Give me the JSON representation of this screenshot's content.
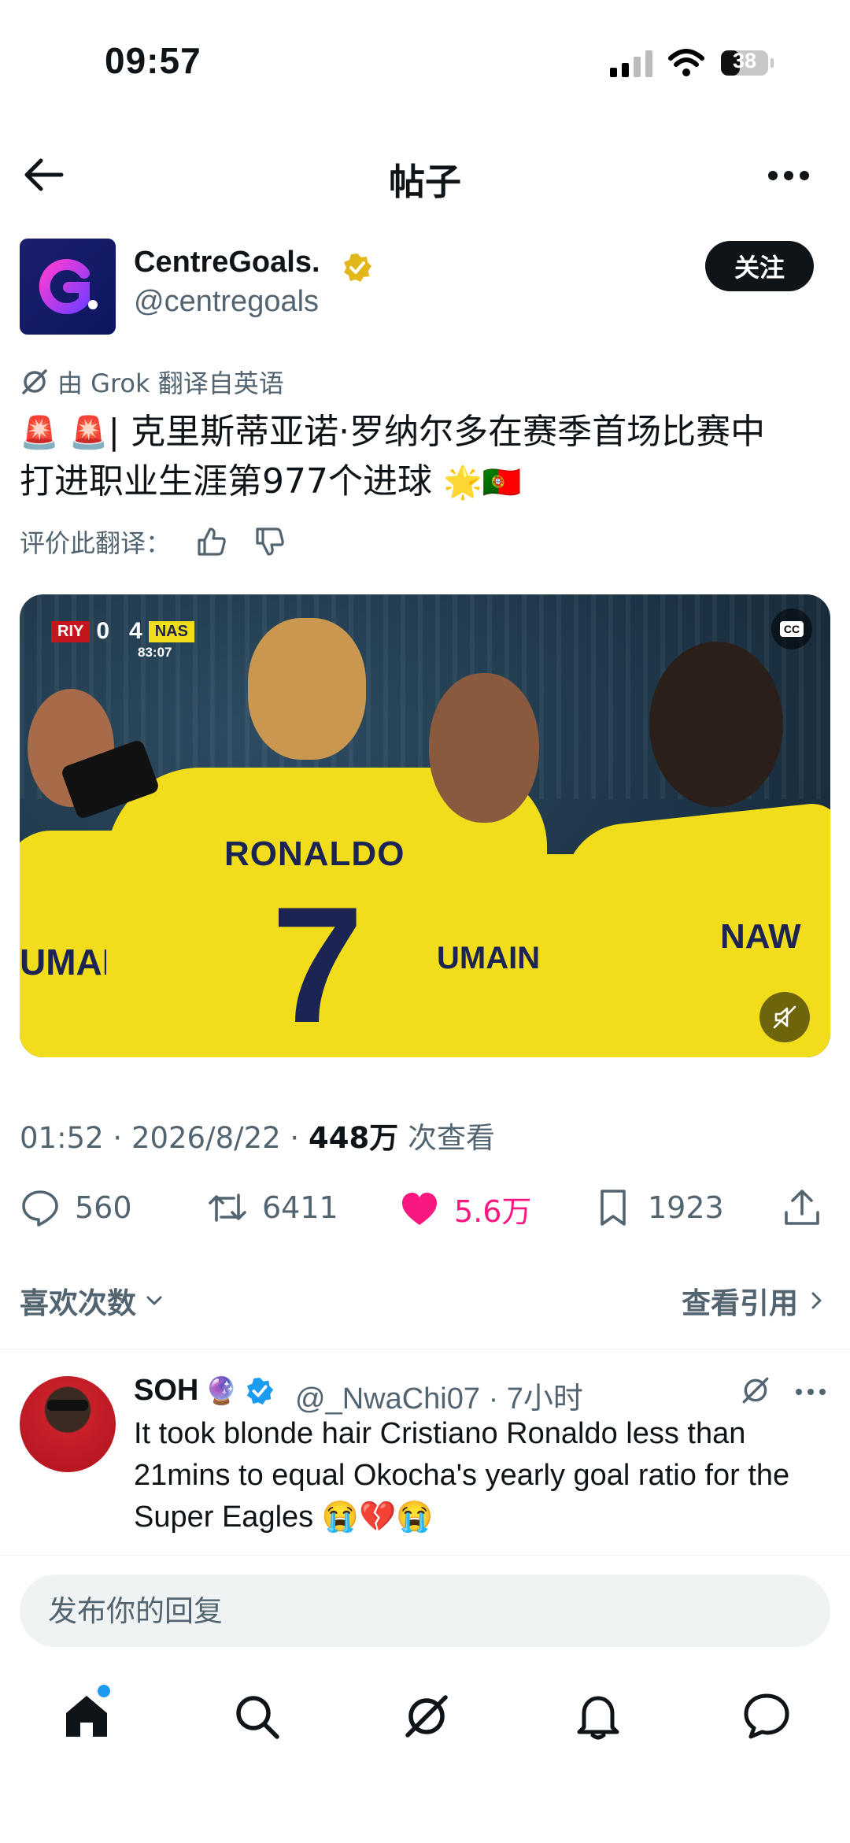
{
  "status_bar": {
    "time": "09:57",
    "battery": "38"
  },
  "header": {
    "title": "帖子"
  },
  "post": {
    "author_name": "CentreGoals.",
    "author_handle": "@centregoals",
    "follow_label": "关注",
    "translated_note": "由 Grok 翻译自英语",
    "text_emoji_prefix": "🚨 🚨",
    "text_line1": "| 克里斯蒂亚诺·罗纳尔多在赛季首场比赛中",
    "text_line2": "打进职业生涯第977个进球",
    "text_emoji_suffix": "🌟🇵🇹",
    "rate_label": "评价此翻译：",
    "media": {
      "scoreboard_home": "RIY",
      "scoreboard_score": "0   4",
      "scoreboard_away": "NAS",
      "scoreboard_time": "83:07",
      "shirt_name": "RONALDO",
      "shirt_number": "7",
      "shirt_left": "UMAIN",
      "shirt_mid": "UMAIN",
      "shirt_right": "NAW",
      "cc_label": "CC"
    },
    "time": "01:52",
    "date": "2026/8/22",
    "views_count": "448万",
    "views_label": "次查看",
    "replies": "560",
    "reposts": "6411",
    "likes": "5.6万",
    "bookmarks": "1923",
    "likes_label": "喜欢次数",
    "quotes_label": "查看引用"
  },
  "reply": {
    "name": "SOH",
    "name_emoji": "🔮",
    "handle_time": "@_NwaChi07 · 7小时",
    "text": "It took blonde hair Cristiano Ronaldo less than 21mins to equal Okocha's yearly goal ratio for the Super Eagles 😭💔😭"
  },
  "compose": {
    "placeholder": "发布你的回复"
  },
  "colors": {
    "like": "#f91880",
    "verified_gold": "#e2b719",
    "verified_blue": "#1d9bf0",
    "dot_blue": "#1d9bf0"
  },
  "icons": [
    "back-arrow-icon",
    "more-icon",
    "verified-gold-icon",
    "grok-icon",
    "thumbs-up-icon",
    "thumbs-down-icon",
    "reply-icon",
    "repost-icon",
    "heart-icon",
    "bookmark-icon",
    "share-icon",
    "chevron-down-icon",
    "chevron-right-icon",
    "verified-blue-icon",
    "home-icon",
    "search-icon",
    "grok-tab-icon",
    "bell-icon",
    "messages-icon",
    "mute-icon",
    "cc-icon"
  ]
}
